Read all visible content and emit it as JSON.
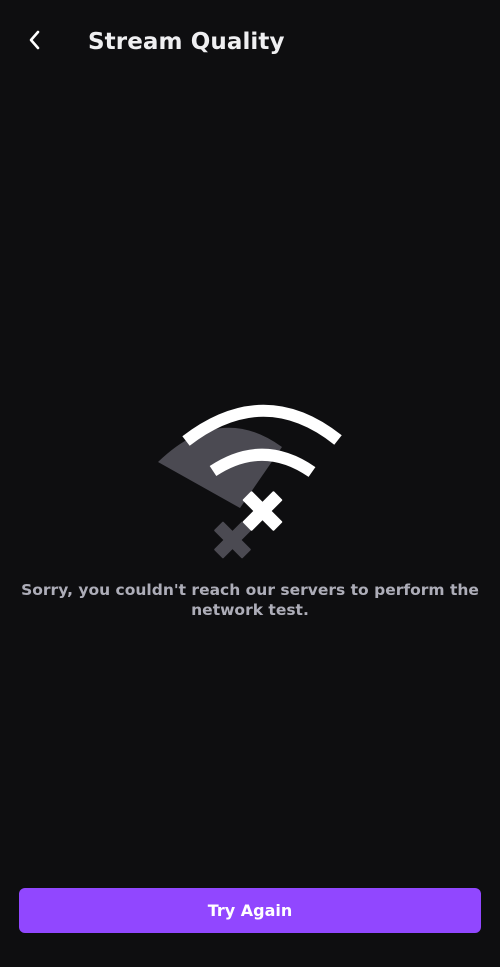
{
  "header": {
    "back_icon": "chevron-left-icon",
    "title": "Stream Quality"
  },
  "error": {
    "illustration_icon": "wifi-error-icon",
    "message": "Sorry, you couldn't reach our servers to perform the network test."
  },
  "actions": {
    "try_again_label": "Try Again"
  },
  "colors": {
    "background": "#0e0e10",
    "title_text": "#efeff1",
    "message_text": "#adadb8",
    "accent": "#9147ff",
    "illustration_shadow": "#4b4a52",
    "illustration_fg": "#ffffff"
  }
}
